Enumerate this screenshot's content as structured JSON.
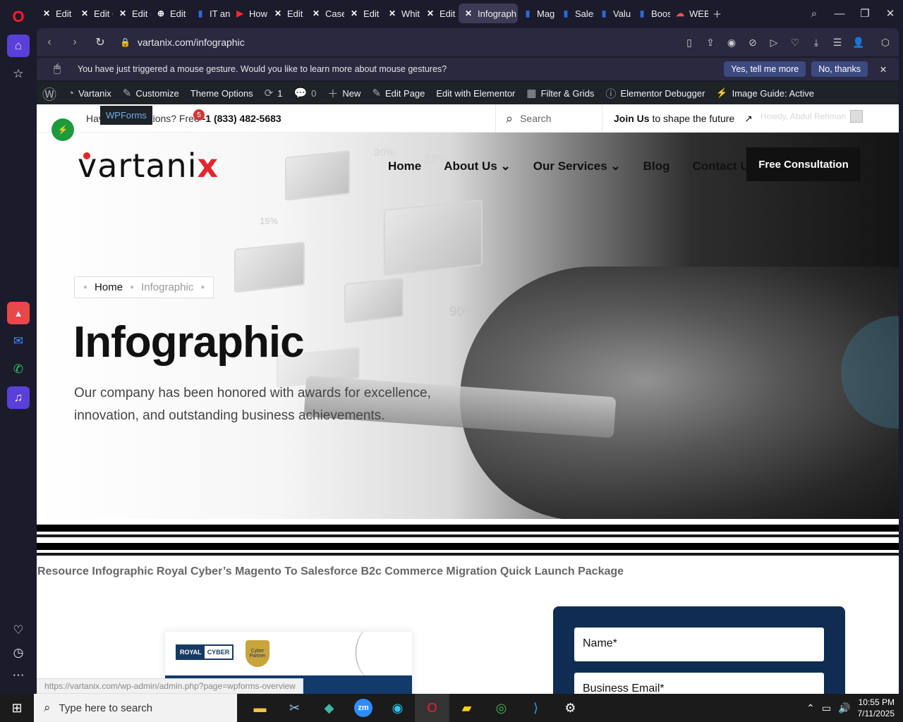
{
  "browser": {
    "tabs": [
      {
        "label": "Edit I",
        "icon": "elementor-icon"
      },
      {
        "label": "Edit C",
        "icon": "elementor-icon"
      },
      {
        "label": "Edit (",
        "icon": "elementor-icon"
      },
      {
        "label": "Edit",
        "icon": "globe-icon"
      },
      {
        "label": "IT an",
        "icon": "document-icon"
      },
      {
        "label": "How",
        "icon": "youtube-icon"
      },
      {
        "label": "Edit",
        "icon": "elementor-icon"
      },
      {
        "label": "Case",
        "icon": "elementor-icon"
      },
      {
        "label": "Edit",
        "icon": "elementor-icon"
      },
      {
        "label": "Whit",
        "icon": "elementor-icon"
      },
      {
        "label": "Edit",
        "icon": "elementor-icon"
      },
      {
        "label": "Infograph",
        "icon": "elementor-icon",
        "active": true
      },
      {
        "label": "Mag",
        "icon": "document-icon"
      },
      {
        "label": "Sales",
        "icon": "document-icon"
      },
      {
        "label": "Valu",
        "icon": "document-icon"
      },
      {
        "label": "Boos",
        "icon": "document-icon"
      },
      {
        "label": "WEB",
        "icon": "cloud-icon"
      }
    ],
    "url": "vartanix.com/infographic",
    "notification": {
      "text": "You have just triggered a mouse gesture. Would you like to learn more about mouse gestures?",
      "yes": "Yes, tell me more",
      "no": "No, thanks"
    }
  },
  "wp_admin_bar": {
    "site": "Vartanix",
    "customize": "Customize",
    "theme_options": "Theme Options",
    "updates": "1",
    "comments": "0",
    "new": "New",
    "edit_page": "Edit Page",
    "edit_elementor": "Edit with Elementor",
    "filter_grids": "Filter & Grids",
    "debugger": "Elementor Debugger",
    "image_guide": "Image Guide: Active"
  },
  "topstrip": {
    "wpforms_tooltip": "WPForms",
    "badge_count": "5",
    "phone_prefix": "Hav",
    "phone_mid": "tions? Free",
    "phone": "-1 (833) 482-5683",
    "search_placeholder": "Search",
    "join_bold": "Join Us",
    "join_rest": " to shape the future",
    "howdy": "Howdy, Abdul Rehman"
  },
  "site": {
    "logo_text": "vartani",
    "logo_x": "x",
    "menu": [
      "Home",
      "About Us",
      "Our Services",
      "Blog",
      "Contact Us"
    ],
    "cta": "Free Consultation",
    "hero_pcts": [
      "30%",
      "30%",
      "15%",
      "90%"
    ],
    "breadcrumb": {
      "home": "Home",
      "current": "Infographic"
    },
    "title": "Infographic",
    "subtitle": "Our company has been honored with awards for excellence, innovation, and outstanding business achievements.",
    "resource_line": "Resource Infographic Royal Cyber’s Magento To Salesforce B2c Commerce Migration Quick Launch Package",
    "preview": {
      "brand_a": "ROYAL",
      "brand_b": "CYBER",
      "badge": "Cyber Partner"
    },
    "form": {
      "name": "Name*",
      "email": "Business Email*"
    }
  },
  "status_url": "https://vartanix.com/wp-admin/admin.php?page=wpforms-overview",
  "taskbar": {
    "search_placeholder": "Type here to search",
    "time": "10:55 PM",
    "date": "7/11/2025"
  }
}
